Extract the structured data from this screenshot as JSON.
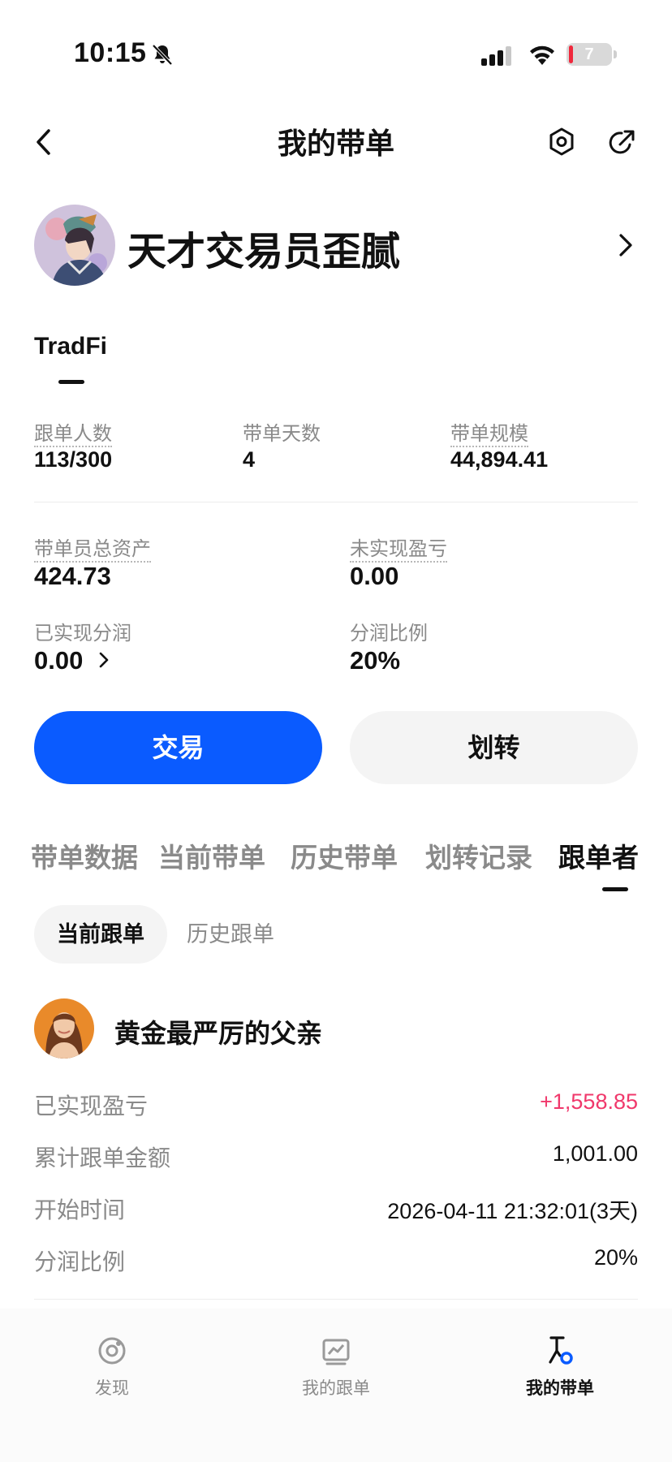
{
  "status_bar": {
    "time": "10:15",
    "battery": "7"
  },
  "nav": {
    "title": "我的带单"
  },
  "profile": {
    "name": "天才交易员歪腻"
  },
  "account_tab": {
    "label": "TradFi"
  },
  "stats": [
    {
      "label": "跟单人数",
      "value": "113/300"
    },
    {
      "label": "带单天数",
      "value": "4"
    },
    {
      "label": "带单规模",
      "value": "44,894.41"
    }
  ],
  "assets": {
    "total_assets": {
      "label": "带单员总资产",
      "value": "424.73"
    },
    "unrealized_pnl": {
      "label": "未实现盈亏",
      "value": "0.00"
    },
    "realized_share": {
      "label": "已实现分润",
      "value": "0.00"
    },
    "share_ratio": {
      "label": "分润比例",
      "value": "20%"
    }
  },
  "buttons": {
    "trade": "交易",
    "transfer": "划转"
  },
  "tabs": [
    "带单数据",
    "当前带单",
    "历史带单",
    "划转记录",
    "跟单者"
  ],
  "active_tab": "跟单者",
  "sub_tabs": [
    "当前跟单",
    "历史跟单"
  ],
  "follower": {
    "name": "黄金最严厉的父亲",
    "rows": [
      {
        "label": "已实现盈亏",
        "value": "+1,558.85"
      },
      {
        "label": "累计跟单金额",
        "value": "1,001.00"
      },
      {
        "label": "开始时间",
        "value": "2026-04-11 21:32:01(3天)"
      },
      {
        "label": "分润比例",
        "value": "20%"
      }
    ]
  },
  "bottom_nav": [
    {
      "label": "发现",
      "icon": "discover-icon"
    },
    {
      "label": "我的跟单",
      "icon": "chart-icon"
    },
    {
      "label": "我的带单",
      "icon": "lead-icon"
    }
  ],
  "colors": {
    "accent": "#0a5bff",
    "positive": "#f0386b",
    "muted": "#8a8a8a"
  }
}
